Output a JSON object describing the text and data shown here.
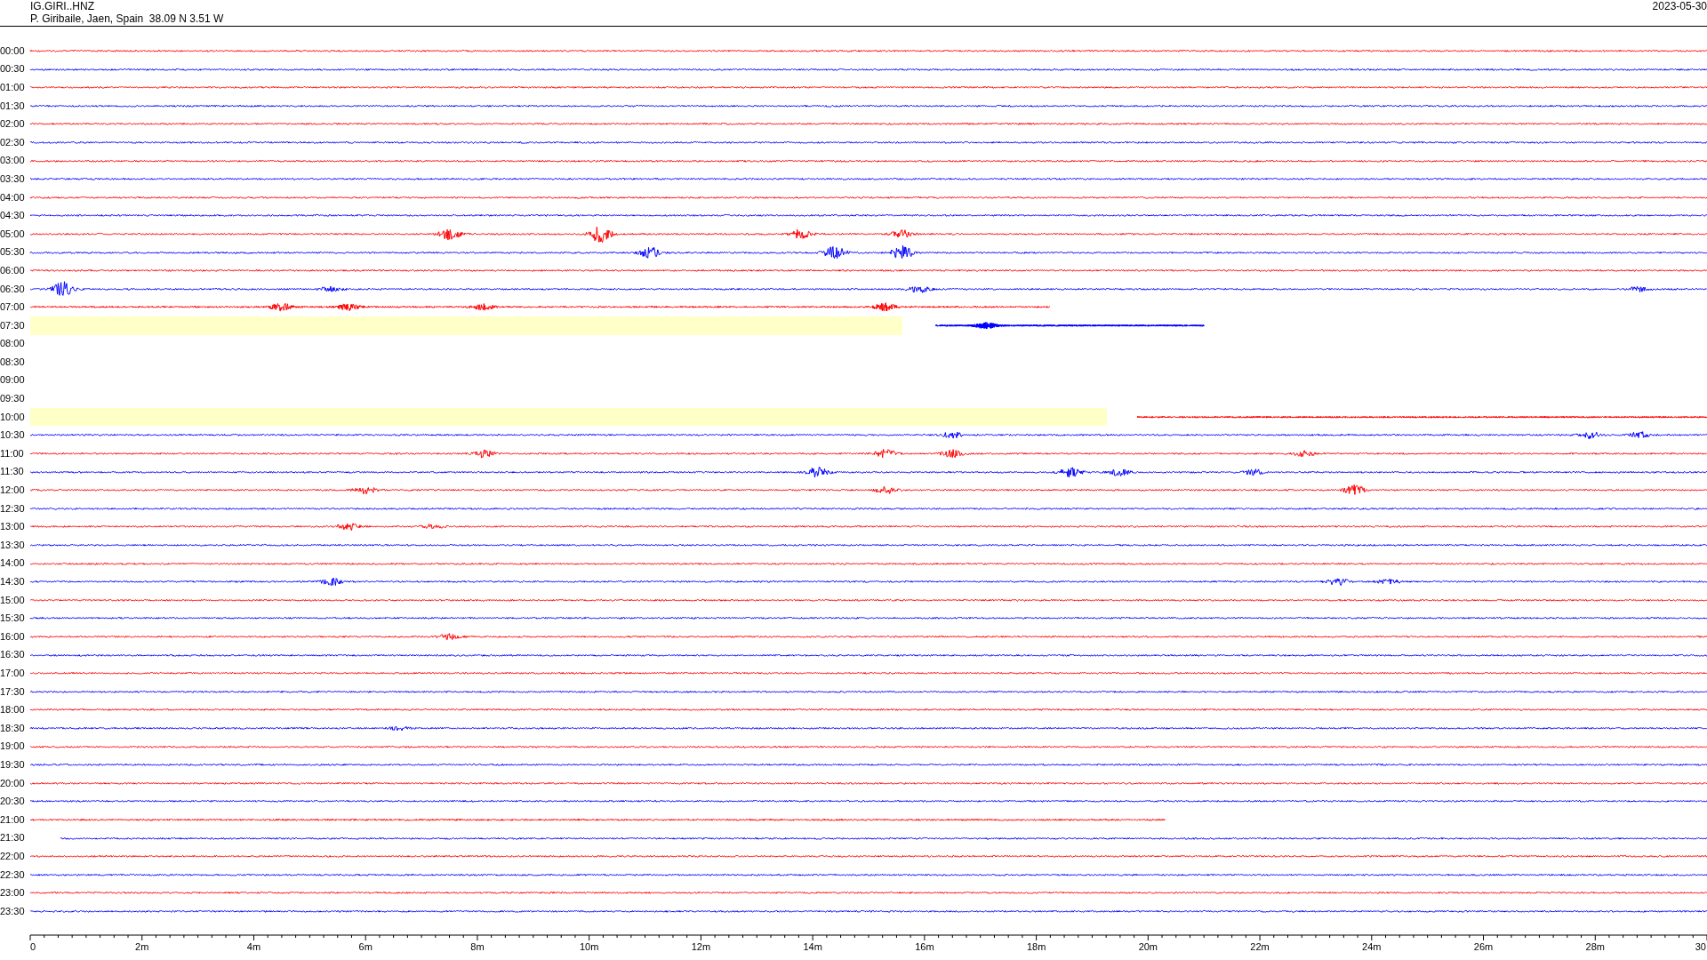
{
  "header": {
    "station": "IG.GIRI..HNZ",
    "location": "P. Giribaile, Jaen, Spain  38.09 N 3.51 W",
    "date": "2023-05-30"
  },
  "rows": [
    {
      "label": "00:00",
      "color": "#ff0000",
      "highlighted": false
    },
    {
      "label": "00:30",
      "color": "#0000ff",
      "highlighted": false
    },
    {
      "label": "01:00",
      "color": "#ff0000",
      "highlighted": false
    },
    {
      "label": "01:30",
      "color": "#0000ff",
      "highlighted": false
    },
    {
      "label": "02:00",
      "color": "#ff0000",
      "highlighted": false
    },
    {
      "label": "02:30",
      "color": "#0000ff",
      "highlighted": false
    },
    {
      "label": "03:00",
      "color": "#ff0000",
      "highlighted": false
    },
    {
      "label": "03:30",
      "color": "#0000ff",
      "highlighted": false
    },
    {
      "label": "04:00",
      "color": "#ff0000",
      "highlighted": false
    },
    {
      "label": "04:30",
      "color": "#0000ff",
      "highlighted": false
    },
    {
      "label": "05:00",
      "color": "#ff0000",
      "highlighted": false
    },
    {
      "label": "05:30",
      "color": "#0000ff",
      "highlighted": false
    },
    {
      "label": "06:00",
      "color": "#ff0000",
      "highlighted": false
    },
    {
      "label": "06:30",
      "color": "#0000ff",
      "highlighted": false
    },
    {
      "label": "07:00",
      "color": "#ff0000",
      "highlighted": false
    },
    {
      "label": "07:30",
      "color": "#0000ff",
      "highlighted": true
    },
    {
      "label": "08:00",
      "highlighted": false
    },
    {
      "label": "08:30",
      "highlighted": false
    },
    {
      "label": "09:00",
      "highlighted": false
    },
    {
      "label": "09:30",
      "highlighted": false
    },
    {
      "label": "10:00",
      "color": "#ff0000",
      "highlighted": true
    },
    {
      "label": "10:30",
      "color": "#0000ff",
      "highlighted": false
    },
    {
      "label": "11:00",
      "color": "#ff0000",
      "highlighted": false
    },
    {
      "label": "11:30",
      "color": "#0000ff",
      "highlighted": false
    },
    {
      "label": "12:00",
      "color": "#ff0000",
      "highlighted": false
    },
    {
      "label": "12:30",
      "color": "#0000ff",
      "highlighted": false
    },
    {
      "label": "13:00",
      "color": "#ff0000",
      "highlighted": false
    },
    {
      "label": "13:30",
      "color": "#0000ff",
      "highlighted": false
    },
    {
      "label": "14:00",
      "color": "#ff0000",
      "highlighted": false
    },
    {
      "label": "14:30",
      "color": "#0000ff",
      "highlighted": false
    },
    {
      "label": "15:00",
      "color": "#ff0000",
      "highlighted": false
    },
    {
      "label": "15:30",
      "color": "#0000ff",
      "highlighted": false
    },
    {
      "label": "16:00",
      "color": "#ff0000",
      "highlighted": false
    },
    {
      "label": "16:30",
      "color": "#0000ff",
      "highlighted": false
    },
    {
      "label": "17:00",
      "color": "#ff0000",
      "highlighted": false
    },
    {
      "label": "17:30",
      "color": "#0000ff",
      "highlighted": false
    },
    {
      "label": "18:00",
      "color": "#ff0000",
      "highlighted": false
    },
    {
      "label": "18:30",
      "color": "#0000ff",
      "highlighted": false
    },
    {
      "label": "19:00",
      "color": "#ff0000",
      "highlighted": false
    },
    {
      "label": "19:30",
      "color": "#0000ff",
      "highlighted": false
    },
    {
      "label": "20:00",
      "color": "#ff0000",
      "highlighted": false
    },
    {
      "label": "20:30",
      "color": "#0000ff",
      "highlighted": false
    },
    {
      "label": "21:00",
      "color": "#ff0000",
      "highlighted": false
    },
    {
      "label": "21:30",
      "color": "#0000ff",
      "highlighted": false
    },
    {
      "label": "22:00",
      "color": "#ff0000",
      "highlighted": false
    },
    {
      "label": "22:30",
      "color": "#0000ff",
      "highlighted": false
    },
    {
      "label": "23:00",
      "color": "#ff0000",
      "highlighted": false
    },
    {
      "label": "23:30",
      "color": "#0000ff",
      "highlighted": false
    }
  ],
  "axis": {
    "tick_labels": [
      "0",
      "2m",
      "4m",
      "6m",
      "8m",
      "10m",
      "12m",
      "14m",
      "16m",
      "18m",
      "20m",
      "22m",
      "24m",
      "26m",
      "28m",
      "30"
    ]
  }
}
